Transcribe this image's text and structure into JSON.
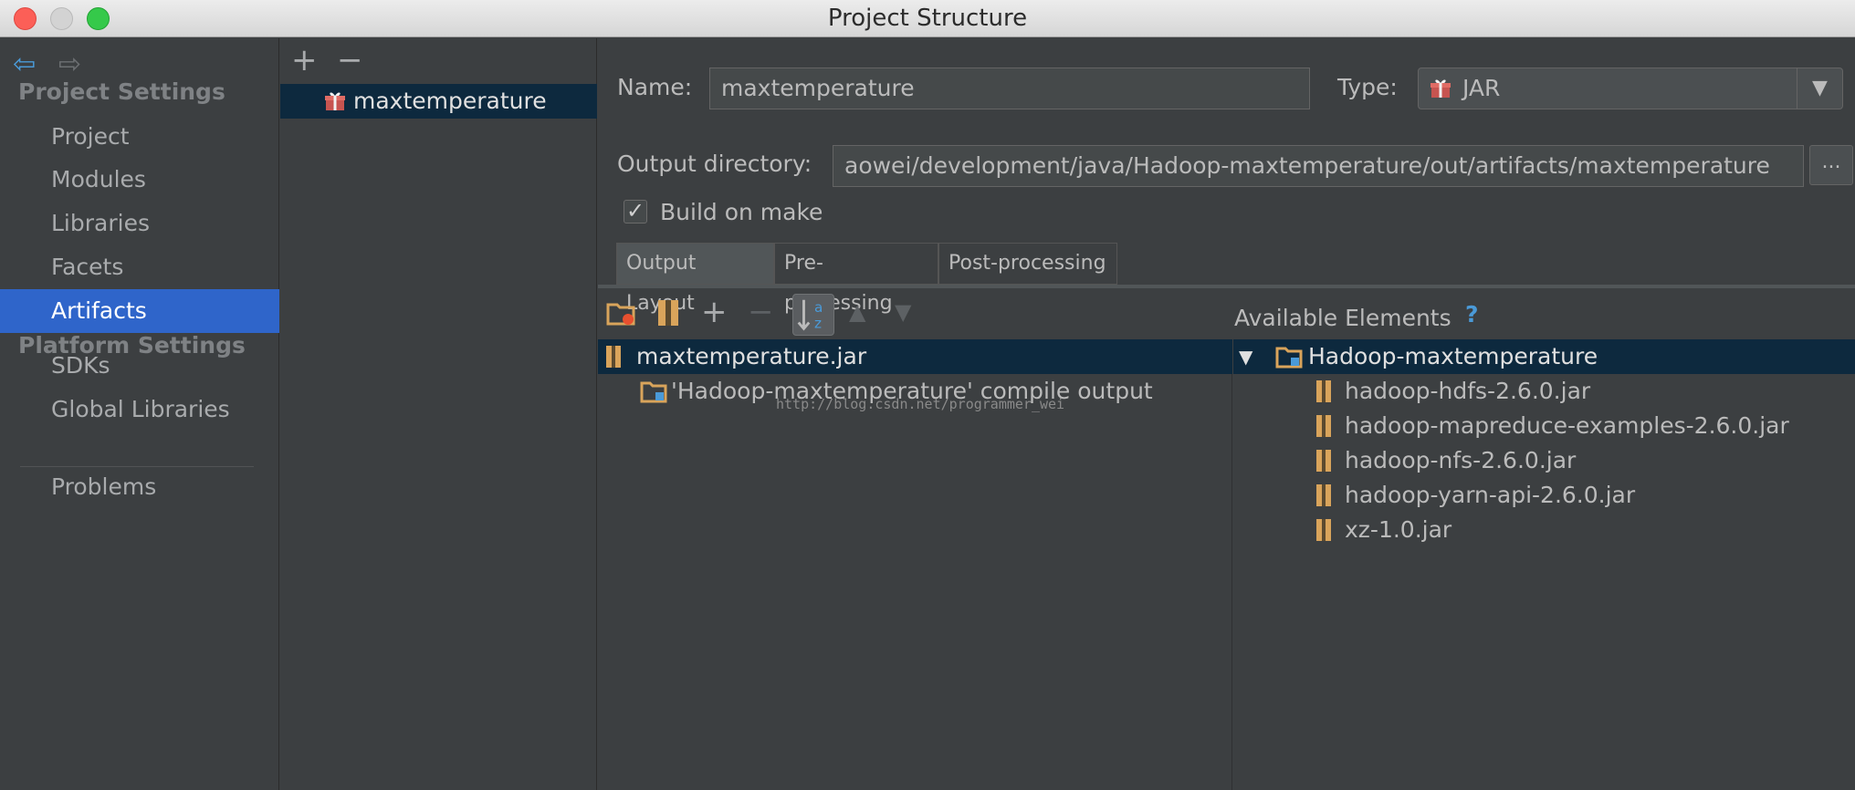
{
  "window": {
    "title": "Project Structure"
  },
  "sidebar": {
    "project_settings_header": "Project Settings",
    "project_items": [
      "Project",
      "Modules",
      "Libraries",
      "Facets",
      "Artifacts"
    ],
    "selected_item": "Artifacts",
    "platform_settings_header": "Platform Settings",
    "platform_items": [
      "SDKs",
      "Global Libraries"
    ],
    "problems": "Problems"
  },
  "artifact_list": {
    "items": [
      "maxtemperature"
    ]
  },
  "artifact": {
    "name_label": "Name:",
    "name_value": "maxtemperature",
    "type_label": "Type:",
    "type_value": "JAR",
    "output_dir_label": "Output directory:",
    "output_dir_value": "aowei/development/java/Hadoop-maxtemperature/out/artifacts/maxtemperature",
    "browse_label": "...",
    "build_on_make_label": "Build on make",
    "build_on_make_checked": true
  },
  "tabs": [
    {
      "label": "Output Layout",
      "active": true
    },
    {
      "label": "Pre-processing",
      "active": false
    },
    {
      "label": "Post-processing",
      "active": false
    }
  ],
  "output_layout": {
    "root": "maxtemperature.jar",
    "children": [
      "'Hadoop-maxtemperature' compile output"
    ]
  },
  "available_elements": {
    "title": "Available Elements",
    "help": "?",
    "module": "Hadoop-maxtemperature",
    "libraries": [
      "hadoop-hdfs-2.6.0.jar",
      "hadoop-mapreduce-examples-2.6.0.jar",
      "hadoop-nfs-2.6.0.jar",
      "hadoop-yarn-api-2.6.0.jar",
      "xz-1.0.jar"
    ]
  },
  "watermark": "http://blog.csdn.net/programmer_wei",
  "colors": {
    "selection": "#2f65ca",
    "tree_selection": "#0d293e",
    "background": "#3c3f41",
    "accent_blue": "#4a9ad8"
  }
}
